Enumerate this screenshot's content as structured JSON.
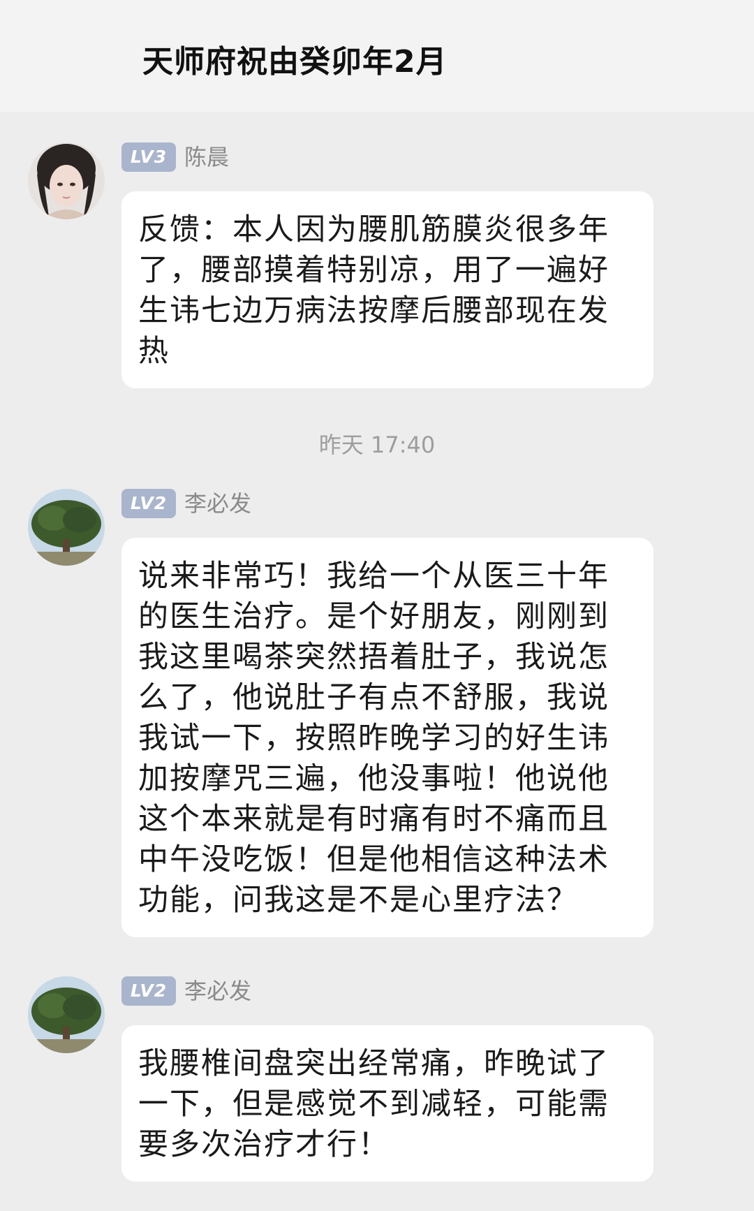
{
  "chat": {
    "title": "天师府祝由癸卯年2月"
  },
  "messages": [
    {
      "level": "LV3",
      "sender": "陈晨",
      "text": "反馈：本人因为腰肌筋膜炎很多年了，腰部摸着特别凉，用了一遍好生讳七边万病法按摩后腰部现在发热"
    },
    {
      "level": "LV2",
      "sender": "李必发",
      "text": "说来非常巧！我给一个从医三十年的医生治疗。是个好朋友，刚刚到我这里喝茶突然捂着肚子，我说怎么了，他说肚子有点不舒服，我说我试一下，按照昨晚学习的好生讳加按摩咒三遍，他没事啦！他说他这个本来就是有时痛有时不痛而且中午没吃饭！但是他相信这种法术功能，问我这是不是心里疗法？"
    },
    {
      "level": "LV2",
      "sender": "李必发",
      "text": "我腰椎间盘突出经常痛，昨晚试了一下，但是感觉不到减轻，可能需要多次治疗才行！"
    }
  ],
  "timestamp": "昨天 17:40"
}
